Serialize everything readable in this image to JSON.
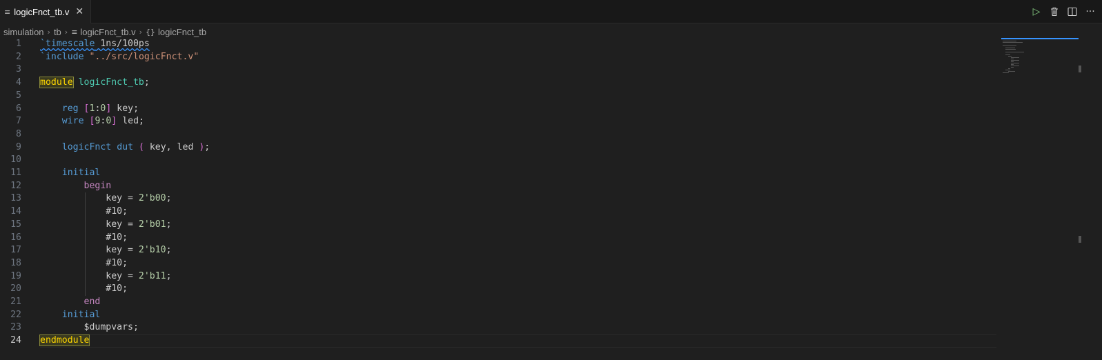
{
  "tab": {
    "file_icon": "list-file-icon",
    "label": "logicFnct_tb.v",
    "close_glyph": "✕"
  },
  "actions": {
    "run_icon": "play-icon",
    "delete_icon": "trash-icon",
    "split_icon": "split-editor-icon",
    "more_icon": "ellipsis-icon"
  },
  "breadcrumb": {
    "items": [
      "simulation",
      "tb",
      "logicFnct_tb.v",
      "logicFnct_tb"
    ],
    "module_glyph": "{}"
  },
  "editor": {
    "active_line": 24,
    "lines": [
      {
        "n": "1",
        "tokens": [
          [
            "`timescale",
            "t-key squiggle"
          ],
          [
            " 1ns/100ps",
            "t-plain squiggle"
          ]
        ]
      },
      {
        "n": "2",
        "tokens": [
          [
            "`include",
            "t-key"
          ],
          [
            " ",
            "t-plain"
          ],
          [
            "\"../src/logicFnct.v\"",
            "t-str"
          ]
        ]
      },
      {
        "n": "3",
        "tokens": []
      },
      {
        "n": "4",
        "tokens": [
          [
            "module",
            "t-hl"
          ],
          [
            " ",
            "t-plain"
          ],
          [
            "logicFnct_tb",
            "t-mod"
          ],
          [
            ";",
            "t-plain"
          ]
        ]
      },
      {
        "n": "5",
        "tokens": []
      },
      {
        "n": "6",
        "tokens": [
          [
            "    ",
            "t-plain"
          ],
          [
            "reg",
            "t-key"
          ],
          [
            " ",
            "t-plain"
          ],
          [
            "[",
            "t-brk"
          ],
          [
            "1",
            "t-num"
          ],
          [
            ":",
            "t-plain"
          ],
          [
            "0",
            "t-num"
          ],
          [
            "]",
            "t-brk"
          ],
          [
            " key;",
            "t-plain"
          ]
        ]
      },
      {
        "n": "7",
        "tokens": [
          [
            "    ",
            "t-plain"
          ],
          [
            "wire",
            "t-key"
          ],
          [
            " ",
            "t-plain"
          ],
          [
            "[",
            "t-brk"
          ],
          [
            "9",
            "t-num"
          ],
          [
            ":",
            "t-plain"
          ],
          [
            "0",
            "t-num"
          ],
          [
            "]",
            "t-brk"
          ],
          [
            " led;",
            "t-plain"
          ]
        ]
      },
      {
        "n": "8",
        "tokens": []
      },
      {
        "n": "9",
        "tokens": [
          [
            "    ",
            "t-plain"
          ],
          [
            "logicFnct",
            "t-key"
          ],
          [
            " ",
            "t-plain"
          ],
          [
            "dut",
            "t-key"
          ],
          [
            " ",
            "t-plain"
          ],
          [
            "(",
            "t-brk"
          ],
          [
            " key, led ",
            "t-plain"
          ],
          [
            ")",
            "t-brk"
          ],
          [
            ";",
            "t-plain"
          ]
        ]
      },
      {
        "n": "10",
        "tokens": []
      },
      {
        "n": "11",
        "tokens": [
          [
            "    ",
            "t-plain"
          ],
          [
            "initial",
            "t-key"
          ]
        ]
      },
      {
        "n": "12",
        "tokens": [
          [
            "        ",
            "t-plain"
          ],
          [
            "begin",
            "t-ctrl"
          ]
        ]
      },
      {
        "n": "13",
        "tokens": [
          [
            "            key = ",
            "t-plain"
          ],
          [
            "2'b00",
            "t-num"
          ],
          [
            ";",
            "t-plain"
          ]
        ]
      },
      {
        "n": "14",
        "tokens": [
          [
            "            #10;",
            "t-plain"
          ]
        ]
      },
      {
        "n": "15",
        "tokens": [
          [
            "            key = ",
            "t-plain"
          ],
          [
            "2'b01",
            "t-num"
          ],
          [
            ";",
            "t-plain"
          ]
        ]
      },
      {
        "n": "16",
        "tokens": [
          [
            "            #10;",
            "t-plain"
          ]
        ]
      },
      {
        "n": "17",
        "tokens": [
          [
            "            key = ",
            "t-plain"
          ],
          [
            "2'b10",
            "t-num"
          ],
          [
            ";",
            "t-plain"
          ]
        ]
      },
      {
        "n": "18",
        "tokens": [
          [
            "            #10;",
            "t-plain"
          ]
        ]
      },
      {
        "n": "19",
        "tokens": [
          [
            "            key = ",
            "t-plain"
          ],
          [
            "2'b11",
            "t-num"
          ],
          [
            ";",
            "t-plain"
          ]
        ]
      },
      {
        "n": "20",
        "tokens": [
          [
            "            #10;",
            "t-plain"
          ]
        ]
      },
      {
        "n": "21",
        "tokens": [
          [
            "        ",
            "t-plain"
          ],
          [
            "end",
            "t-ctrl"
          ]
        ]
      },
      {
        "n": "22",
        "tokens": [
          [
            "    ",
            "t-plain"
          ],
          [
            "initial",
            "t-key"
          ]
        ]
      },
      {
        "n": "23",
        "tokens": [
          [
            "        $dumpvars;",
            "t-plain"
          ]
        ]
      },
      {
        "n": "24",
        "tokens": [
          [
            "endmodule",
            "t-hl"
          ]
        ]
      }
    ]
  },
  "colors": {
    "background": "#1f1f1f",
    "keyword": "#569cd6",
    "control": "#c586c0",
    "module_name": "#4ec9b0",
    "string": "#ce9178",
    "number": "#b5cea8",
    "bracket": "#da70d6",
    "highlight": "#ffd700"
  }
}
